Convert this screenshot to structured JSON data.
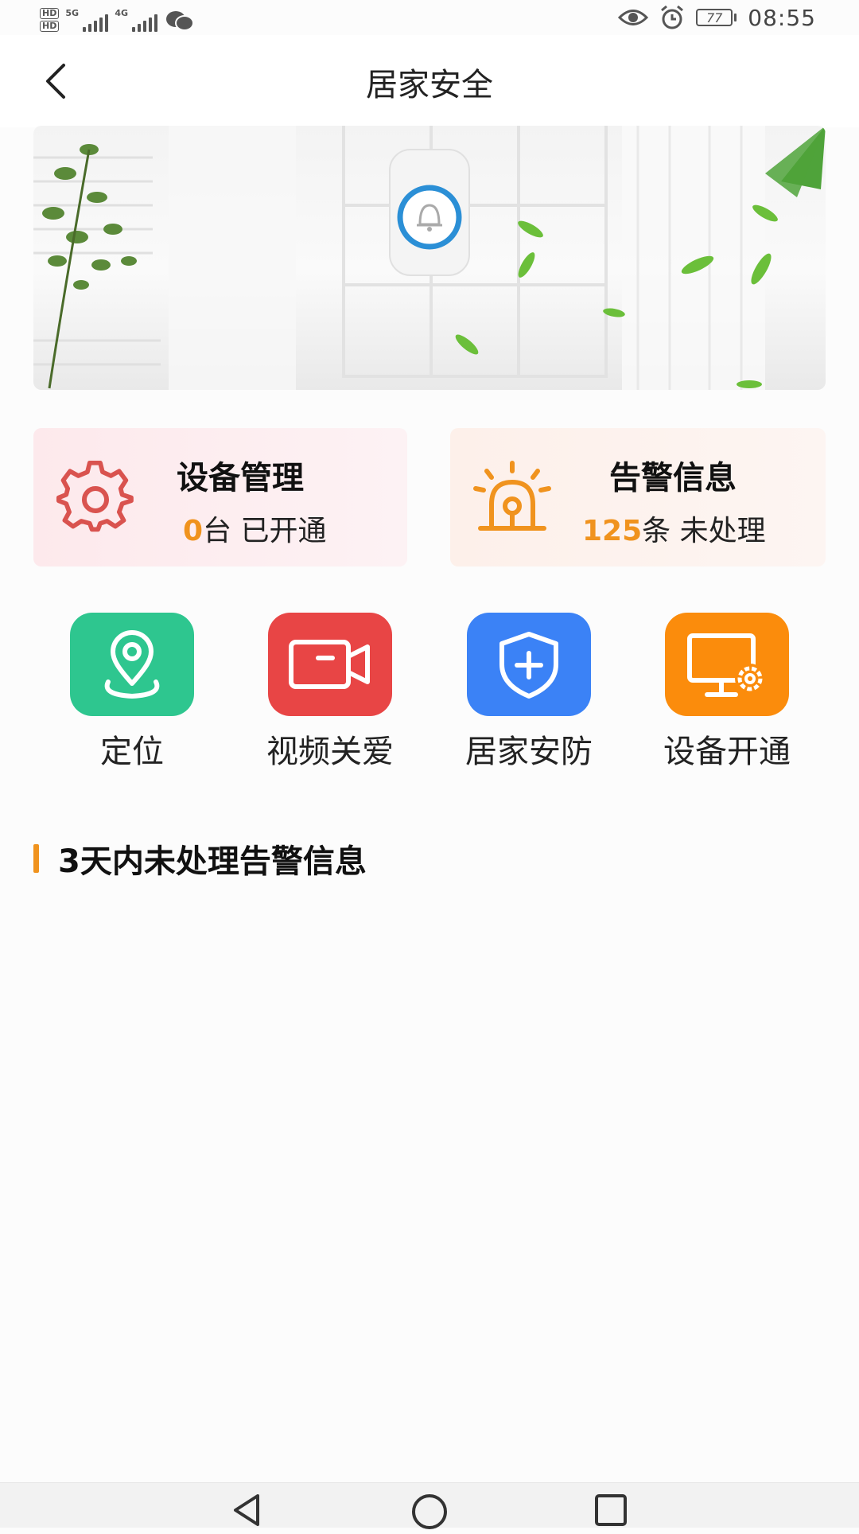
{
  "status_bar": {
    "hd1": "HD",
    "hd2": "HD",
    "net1": "5G",
    "net2": "4G",
    "battery": "77",
    "time": "08:55"
  },
  "header": {
    "title": "居家安全"
  },
  "cards": [
    {
      "title": "设备管理",
      "count": "0",
      "unit": "台",
      "status": "已开通"
    },
    {
      "title": "告警信息",
      "count": "125",
      "unit": "条",
      "status": "未处理"
    }
  ],
  "functions": [
    {
      "label": "定位",
      "color": "#2ec68f"
    },
    {
      "label": "视频关爱",
      "color": "#e84545"
    },
    {
      "label": "居家安防",
      "color": "#3b82f6"
    },
    {
      "label": "设备开通",
      "color": "#fb8c0c"
    }
  ],
  "section": {
    "title": "3天内未处理告警信息"
  },
  "colors": {
    "accent": "#f0931e",
    "gear": "#d9534f"
  }
}
